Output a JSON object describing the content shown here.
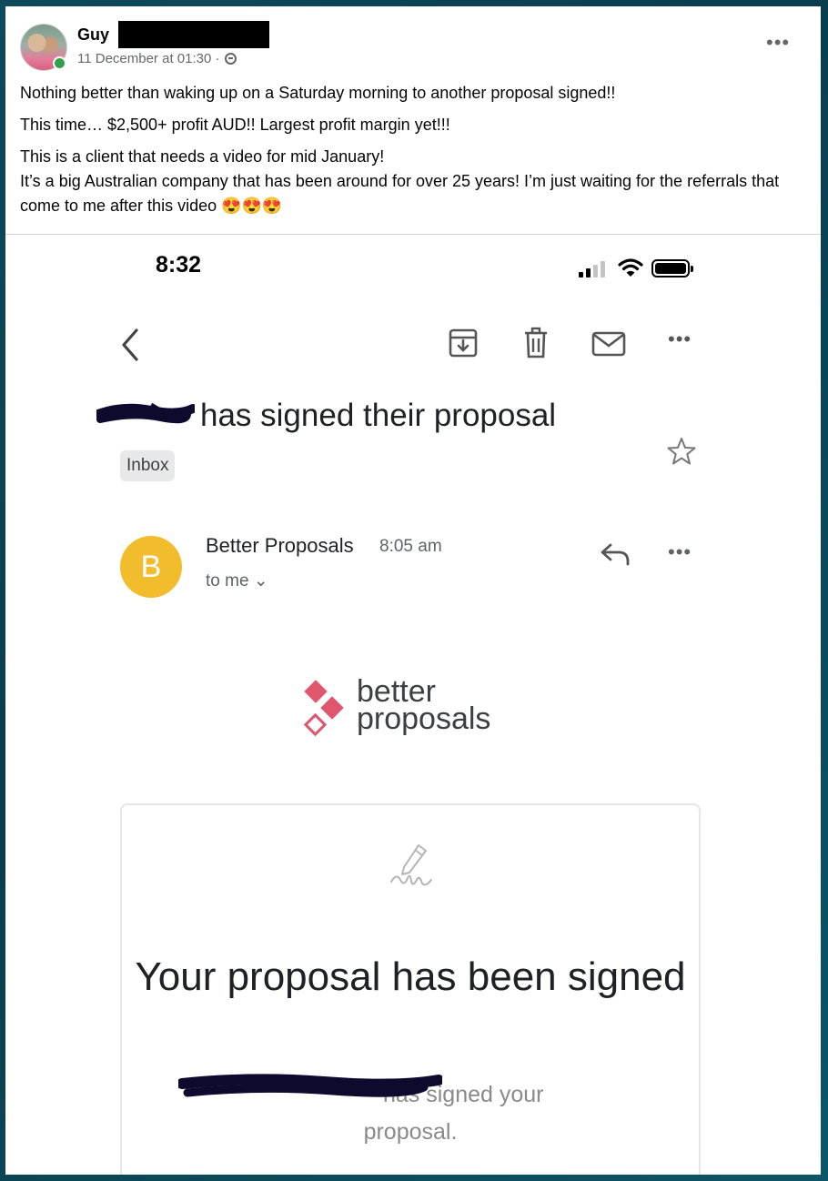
{
  "post": {
    "author": "Guy",
    "timestamp": "11 December at 01:30 ·",
    "visibility_icon": "globe-icon",
    "paragraphs": [
      "Nothing better than waking up on a Saturday morning to another proposal signed!!",
      "This time… $2,500+ profit AUD!! Largest profit margin yet!!!",
      "This is a client that needs a video for mid January!",
      "It’s a big Australian company that has been around for over 25 years! I’m just waiting for the referrals that come to me after this video 😍😍😍"
    ]
  },
  "phone": {
    "status_time": "8:32",
    "signal_bars_active": 2,
    "signal_bars_total": 4
  },
  "email": {
    "subject": "has signed their proposal",
    "label_chip": "Inbox",
    "sender_initial": "B",
    "sender_name": "Better Proposals",
    "sent_time": "8:05 am",
    "recipient": "to me ⌄",
    "logo_line1": "better",
    "logo_line2": "proposals",
    "card_title": "Your proposal has been signed",
    "card_body_suffix": "has signed your",
    "card_body_line2": "proposal.",
    "accent_color": "#e0566f",
    "avatar_color": "#f2bd2c"
  }
}
